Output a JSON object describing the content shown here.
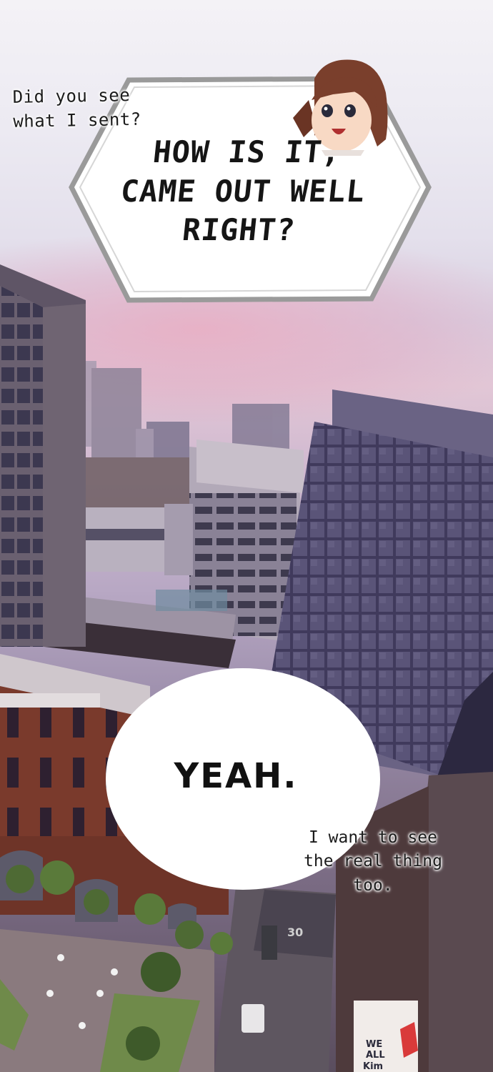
{
  "panel": {
    "caption_top_line1": "Did you see",
    "caption_top_line2": "what I sent?",
    "hex_line1": "HOW IS IT,",
    "hex_line2": "CAME OUT WELL",
    "hex_line3": "RIGHT?",
    "oval_text": "YEAH.",
    "caption_bottom_line1": "I want to see",
    "caption_bottom_line2": "the real thing",
    "caption_bottom_line3": "too.",
    "road_number": "30",
    "billboard_line1": "WE",
    "billboard_line2": "ALL",
    "billboard_line3": "Kim"
  },
  "colors": {
    "bubble_border": "#9a9a9a",
    "bubble_fill": "#ffffff",
    "brick": "#7a3a2c",
    "glass_tower": "#4a4466",
    "hair": "#7a3f2c"
  },
  "icons": {
    "character": "chibi-woman-face-icon"
  }
}
